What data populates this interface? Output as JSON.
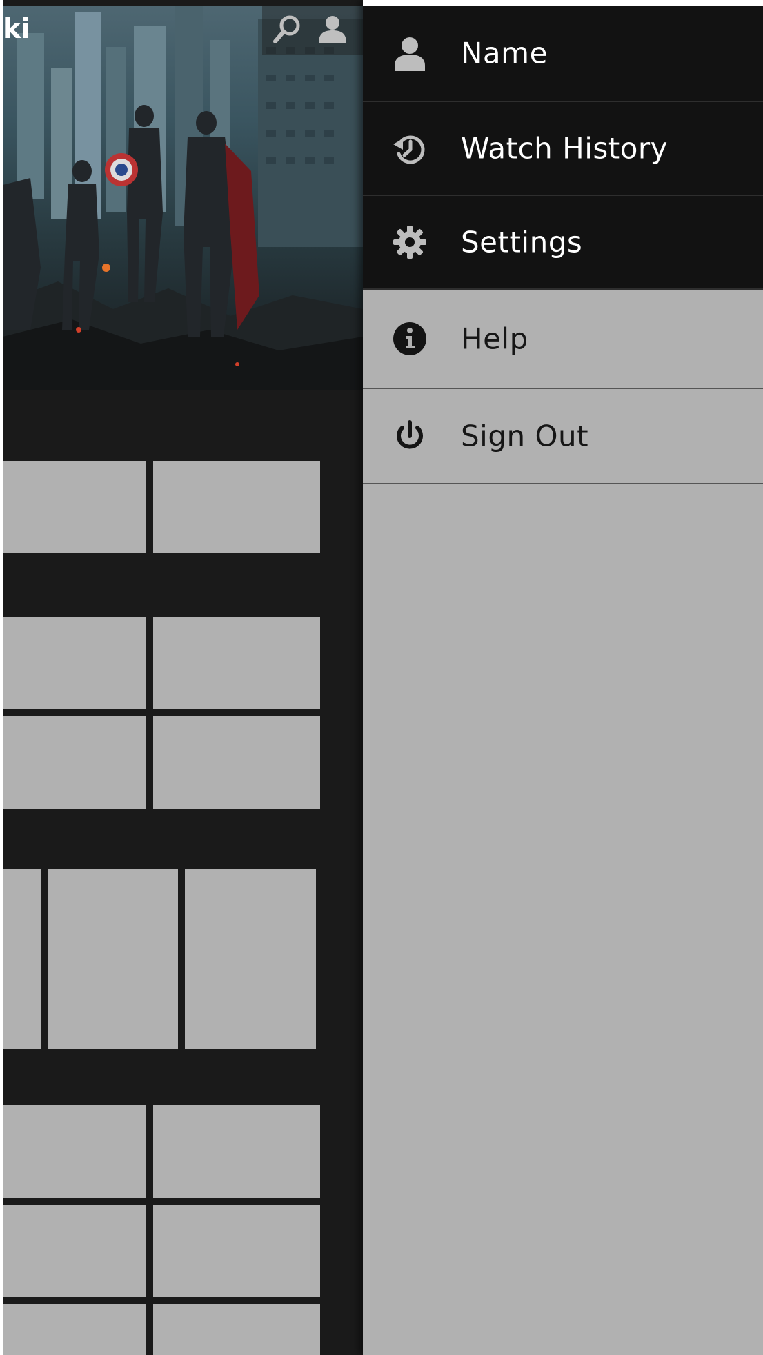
{
  "header": {
    "title_fragment": "ki"
  },
  "header_icons": {
    "search": "search-icon",
    "profile": "profile-icon"
  },
  "drawer": {
    "items": [
      {
        "label": "Name",
        "icon": "user-icon",
        "theme": "dark"
      },
      {
        "label": "Watch History",
        "icon": "history-icon",
        "theme": "dark"
      },
      {
        "label": "Settings",
        "icon": "gear-icon",
        "theme": "dark"
      },
      {
        "label": "Help",
        "icon": "info-icon",
        "theme": "light"
      },
      {
        "label": "Sign Out",
        "icon": "power-icon",
        "theme": "light"
      }
    ]
  },
  "colors": {
    "drawer_dark": "#121212",
    "drawer_light": "#b1b1b1",
    "content_background": "#1a1a1a",
    "placeholder_tile": "#b1b1b1"
  }
}
